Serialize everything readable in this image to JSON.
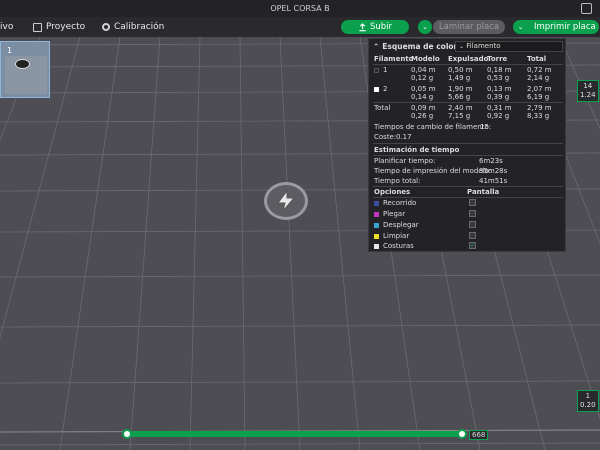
{
  "window": {
    "title": "OPEL CORSA B"
  },
  "toolbar": {
    "item_cut": "ivo",
    "proyecto": "Proyecto",
    "calibracion": "Calibración",
    "subir": "Subir",
    "laminar": "Laminar placa",
    "imprimir": "Imprimir placa"
  },
  "plate": {
    "number": "1"
  },
  "panel": {
    "title": "Esquema de colores",
    "select_value": "Filamento",
    "headers": [
      "Filamento",
      "Modelo",
      "Expulsado",
      "Torre",
      "Total"
    ],
    "rows": [
      {
        "id": "1",
        "color": "#2a2a2e",
        "modelo": [
          "0,04 m",
          "0,12 g"
        ],
        "expulsado": [
          "0,50 m",
          "1,49 g"
        ],
        "torre": [
          "0,18 m",
          "0,53 g"
        ],
        "total": [
          "0,72 m",
          "2,14 g"
        ]
      },
      {
        "id": "2",
        "color": "#ffffff",
        "modelo": [
          "0,05 m",
          "0,14 g"
        ],
        "expulsado": [
          "1,90 m",
          "5,66 g"
        ],
        "torre": [
          "0,13 m",
          "0,39 g"
        ],
        "total": [
          "2,07 m",
          "6,19 g"
        ]
      }
    ],
    "total_row": {
      "label": "Total",
      "modelo": [
        "0,09 m",
        "0,26 g"
      ],
      "expulsado": [
        "2,40 m",
        "7,15 g"
      ],
      "torre": [
        "0,31 m",
        "0,92 g"
      ],
      "total": [
        "2,79 m",
        "8,33 g"
      ]
    },
    "cambio_label": "Tiempos de cambio de filamento:",
    "cambio_value": "15",
    "coste_label": "Coste:",
    "coste_value": "0.17",
    "estimacion_title": "Estimación de tiempo",
    "planificar_label": "Planificar tiempo:",
    "planificar_value": "6m23s",
    "impresion_label": "Tiempo de impresión del modelo:",
    "impresion_value": "35m28s",
    "total_label": "Tiempo total:",
    "total_value": "41m51s",
    "opciones_label": "Opciones",
    "pantalla_label": "Pantalla",
    "options": [
      {
        "label": "Recorrido",
        "color": "#3c4ea0",
        "checked": false
      },
      {
        "label": "Plegar",
        "color": "#c036c0",
        "checked": false
      },
      {
        "label": "Desplegar",
        "color": "#3aa0d0",
        "checked": false
      },
      {
        "label": "Limpiar",
        "color": "#e8e020",
        "checked": false
      },
      {
        "label": "Costuras",
        "color": "#e8e8e8",
        "checked": true
      }
    ]
  },
  "readouts": {
    "top": [
      "14",
      "1.24"
    ],
    "bottom": [
      "1",
      "0.20"
    ]
  },
  "slider": {
    "label": "668"
  },
  "colors": {
    "accent": "#0aa04d"
  }
}
